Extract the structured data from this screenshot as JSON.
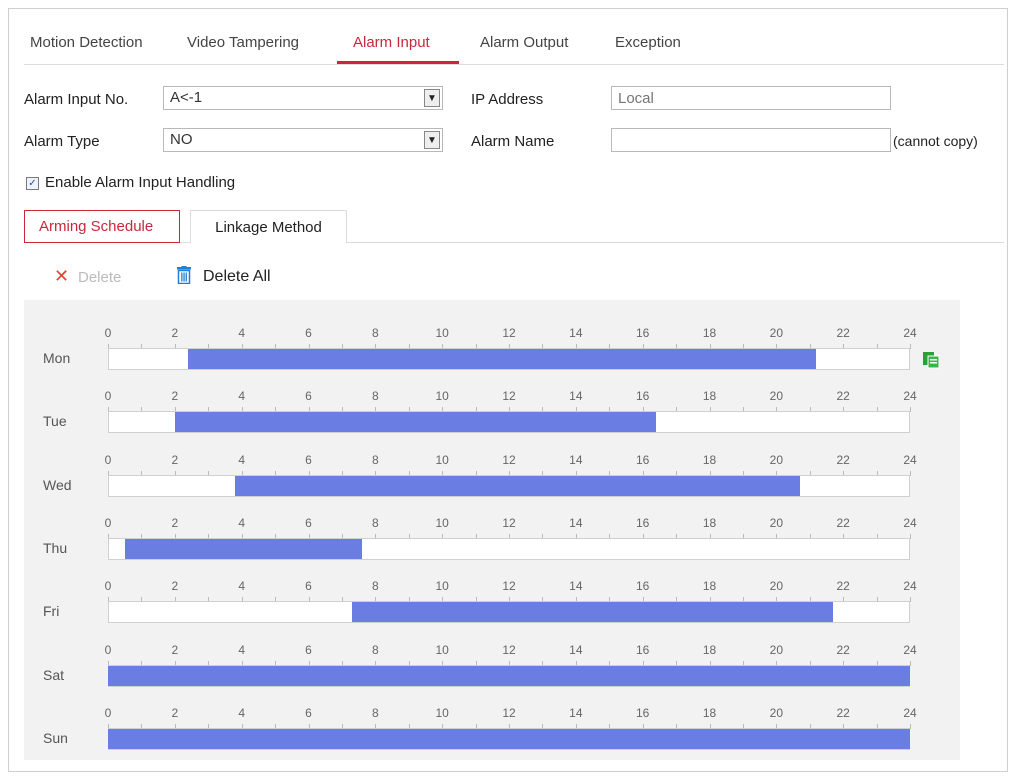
{
  "tabs": [
    {
      "label": "Motion Detection",
      "active": false
    },
    {
      "label": "Video Tampering",
      "active": false
    },
    {
      "label": "Alarm Input",
      "active": true
    },
    {
      "label": "Alarm Output",
      "active": false
    },
    {
      "label": "Exception",
      "active": false
    }
  ],
  "form": {
    "alarm_input_no_label": "Alarm Input No.",
    "alarm_input_no_value": "A<-1",
    "alarm_type_label": "Alarm Type",
    "alarm_type_value": "NO",
    "ip_address_label": "IP Address",
    "ip_address_placeholder": "Local",
    "alarm_name_label": "Alarm Name",
    "alarm_name_value": "",
    "alarm_name_note": "(cannot copy)",
    "enable_handling_label": "Enable Alarm Input Handling",
    "enable_handling_checked": true
  },
  "subtabs": {
    "arming_schedule": "Arming Schedule",
    "linkage_method": "Linkage Method"
  },
  "toolbar": {
    "delete_label": "Delete",
    "delete_all_label": "Delete All"
  },
  "hour_ticks": [
    "0",
    "2",
    "4",
    "6",
    "8",
    "10",
    "12",
    "14",
    "16",
    "18",
    "20",
    "22",
    "24"
  ],
  "schedule": [
    {
      "day": "Mon",
      "start": 2.4,
      "end": 21.2
    },
    {
      "day": "Tue",
      "start": 2.0,
      "end": 16.4
    },
    {
      "day": "Wed",
      "start": 3.8,
      "end": 20.7
    },
    {
      "day": "Thu",
      "start": 0.5,
      "end": 7.6
    },
    {
      "day": "Fri",
      "start": 7.3,
      "end": 21.7
    },
    {
      "day": "Sat",
      "start": 0,
      "end": 24
    },
    {
      "day": "Sun",
      "start": 0,
      "end": 24
    }
  ],
  "colors": {
    "accent": "#c8283b",
    "schedule_bar": "#6a7de2",
    "copy_icon": "#2e9e3c",
    "delete_disabled": "#e8432f",
    "trash_icon": "#1f7fd6"
  },
  "icons": {
    "delete": "close-icon",
    "delete_all": "trash-icon",
    "copy": "copy-icon"
  }
}
